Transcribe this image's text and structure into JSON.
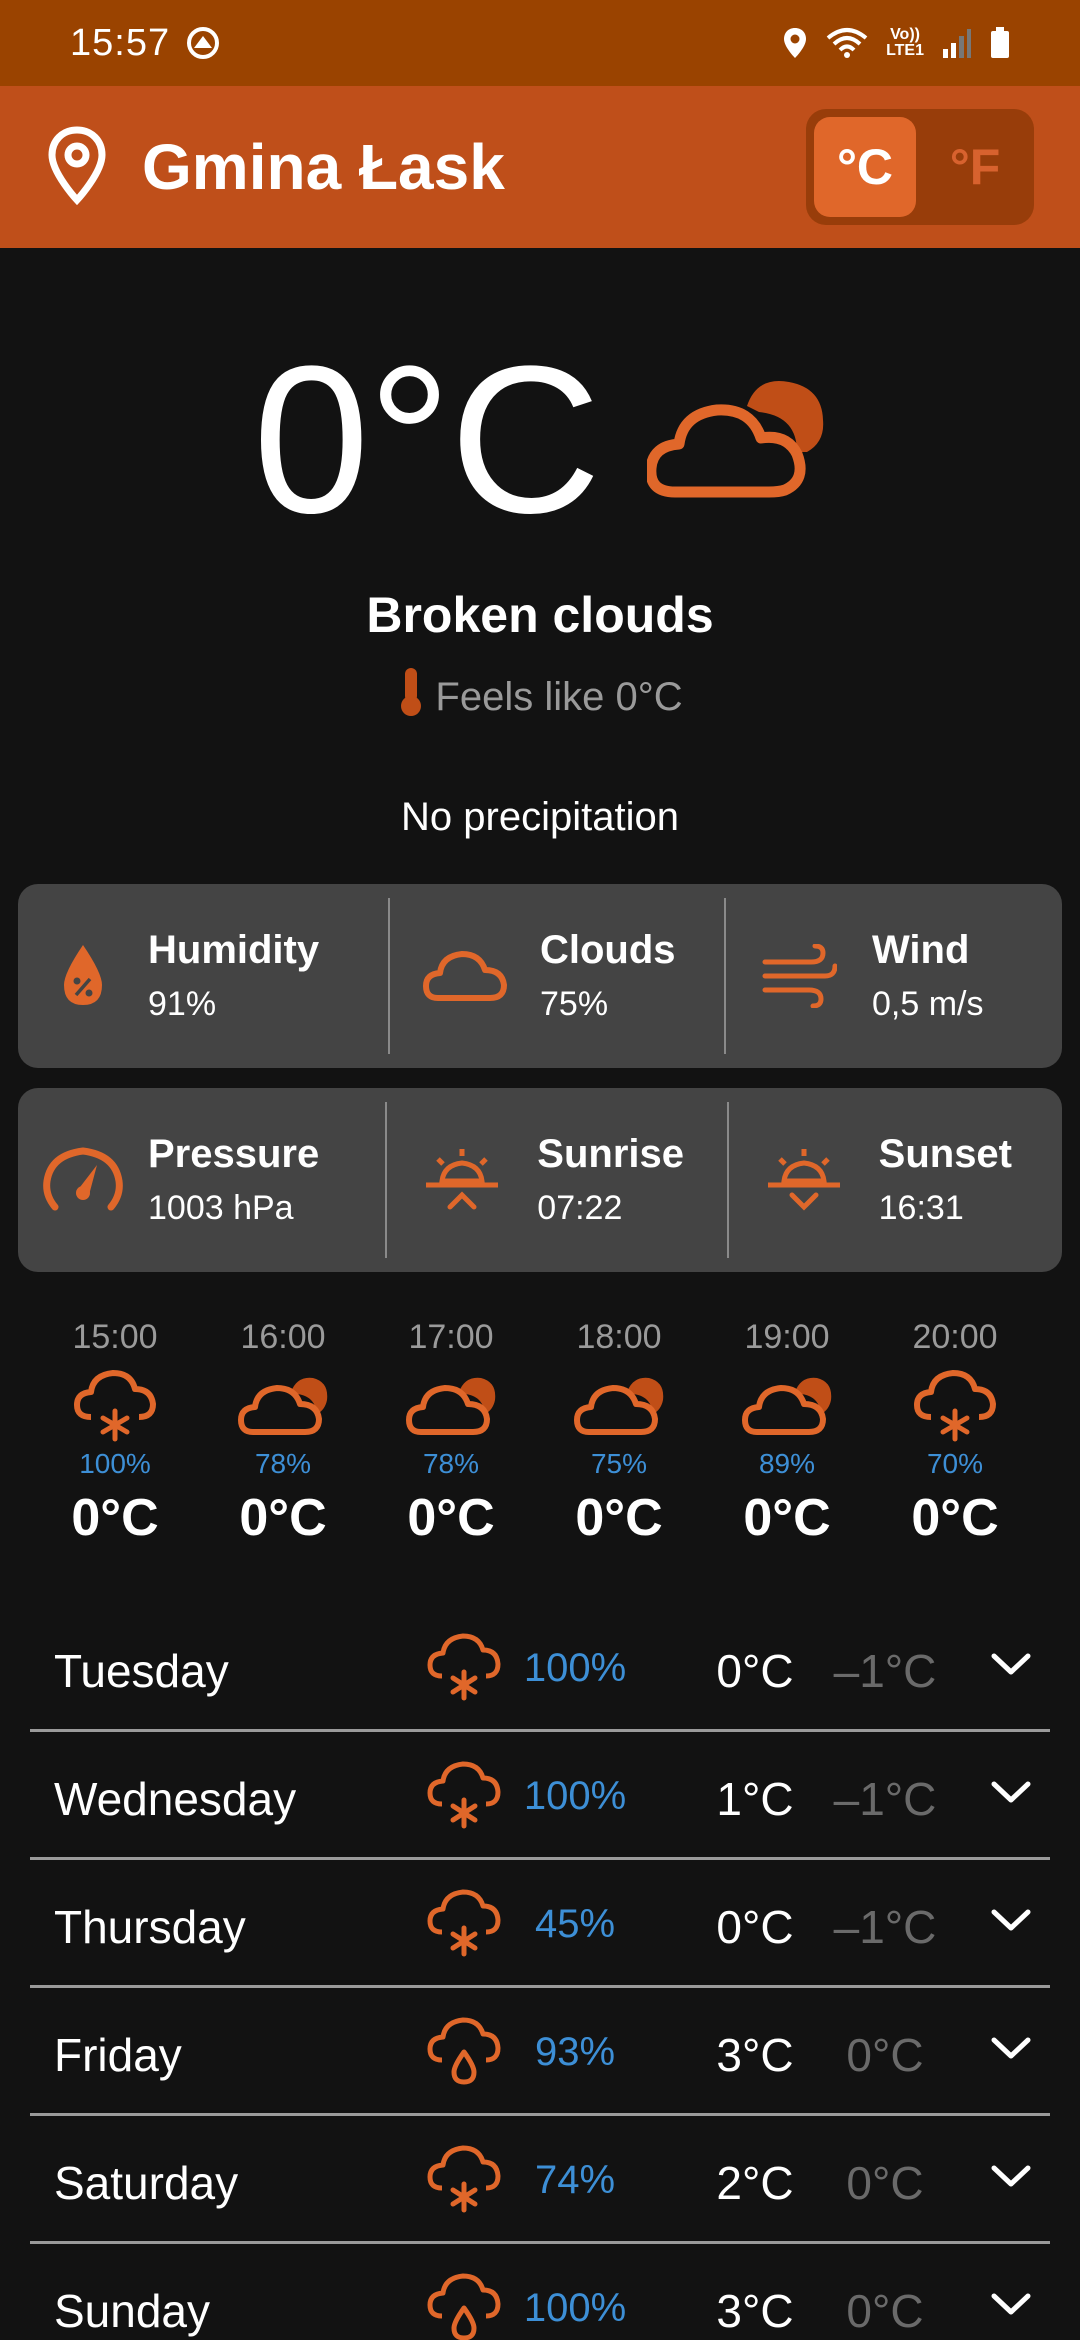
{
  "status_bar": {
    "time": "15:57",
    "volte_top": "Vo))",
    "volte_bottom": "LTE1"
  },
  "app_bar": {
    "city": "Gmina Łask",
    "unit_celsius": "°C",
    "unit_fahrenheit": "°F"
  },
  "current": {
    "temperature": "0°C",
    "condition": "Broken clouds",
    "feels_like": "Feels like 0°C",
    "precipitation": "No precipitation"
  },
  "details": {
    "humidity": {
      "title": "Humidity",
      "value": "91%"
    },
    "clouds": {
      "title": "Clouds",
      "value": "75%"
    },
    "wind": {
      "title": "Wind",
      "value": "0,5  m/s"
    },
    "pressure": {
      "title": "Pressure",
      "value": "1003 hPa"
    },
    "sunrise": {
      "title": "Sunrise",
      "value": "07:22"
    },
    "sunset": {
      "title": "Sunset",
      "value": "16:31"
    }
  },
  "hourly": [
    {
      "time": "15:00",
      "icon": "snow-cloud-icon",
      "pct": "100%",
      "temp": "0°C"
    },
    {
      "time": "16:00",
      "icon": "broken-clouds-icon",
      "pct": "78%",
      "temp": "0°C"
    },
    {
      "time": "17:00",
      "icon": "broken-clouds-icon",
      "pct": "78%",
      "temp": "0°C"
    },
    {
      "time": "18:00",
      "icon": "broken-clouds-icon",
      "pct": "75%",
      "temp": "0°C"
    },
    {
      "time": "19:00",
      "icon": "broken-clouds-icon",
      "pct": "89%",
      "temp": "0°C"
    },
    {
      "time": "20:00",
      "icon": "snow-cloud-icon",
      "pct": "70%",
      "temp": "0°C"
    }
  ],
  "daily": [
    {
      "day": "Tuesday",
      "icon": "snow-cloud-icon",
      "pct": "100%",
      "max": "0°C",
      "min": "–1°C"
    },
    {
      "day": "Wednesday",
      "icon": "snow-cloud-icon",
      "pct": "100%",
      "max": "1°C",
      "min": "–1°C"
    },
    {
      "day": "Thursday",
      "icon": "snow-cloud-icon",
      "pct": "45%",
      "max": "0°C",
      "min": "–1°C"
    },
    {
      "day": "Friday",
      "icon": "rain-cloud-icon",
      "pct": "93%",
      "max": "3°C",
      "min": "0°C"
    },
    {
      "day": "Saturday",
      "icon": "snow-cloud-icon",
      "pct": "74%",
      "max": "2°C",
      "min": "0°C"
    },
    {
      "day": "Sunday",
      "icon": "rain-cloud-icon",
      "pct": "100%",
      "max": "3°C",
      "min": "0°C"
    }
  ],
  "colors": {
    "status_bar": "#9a4300",
    "app_bar": "#bf4f1a",
    "accent": "#e0672a",
    "percent_blue": "#3d8fd6",
    "card": "#444444",
    "background": "#121212"
  }
}
